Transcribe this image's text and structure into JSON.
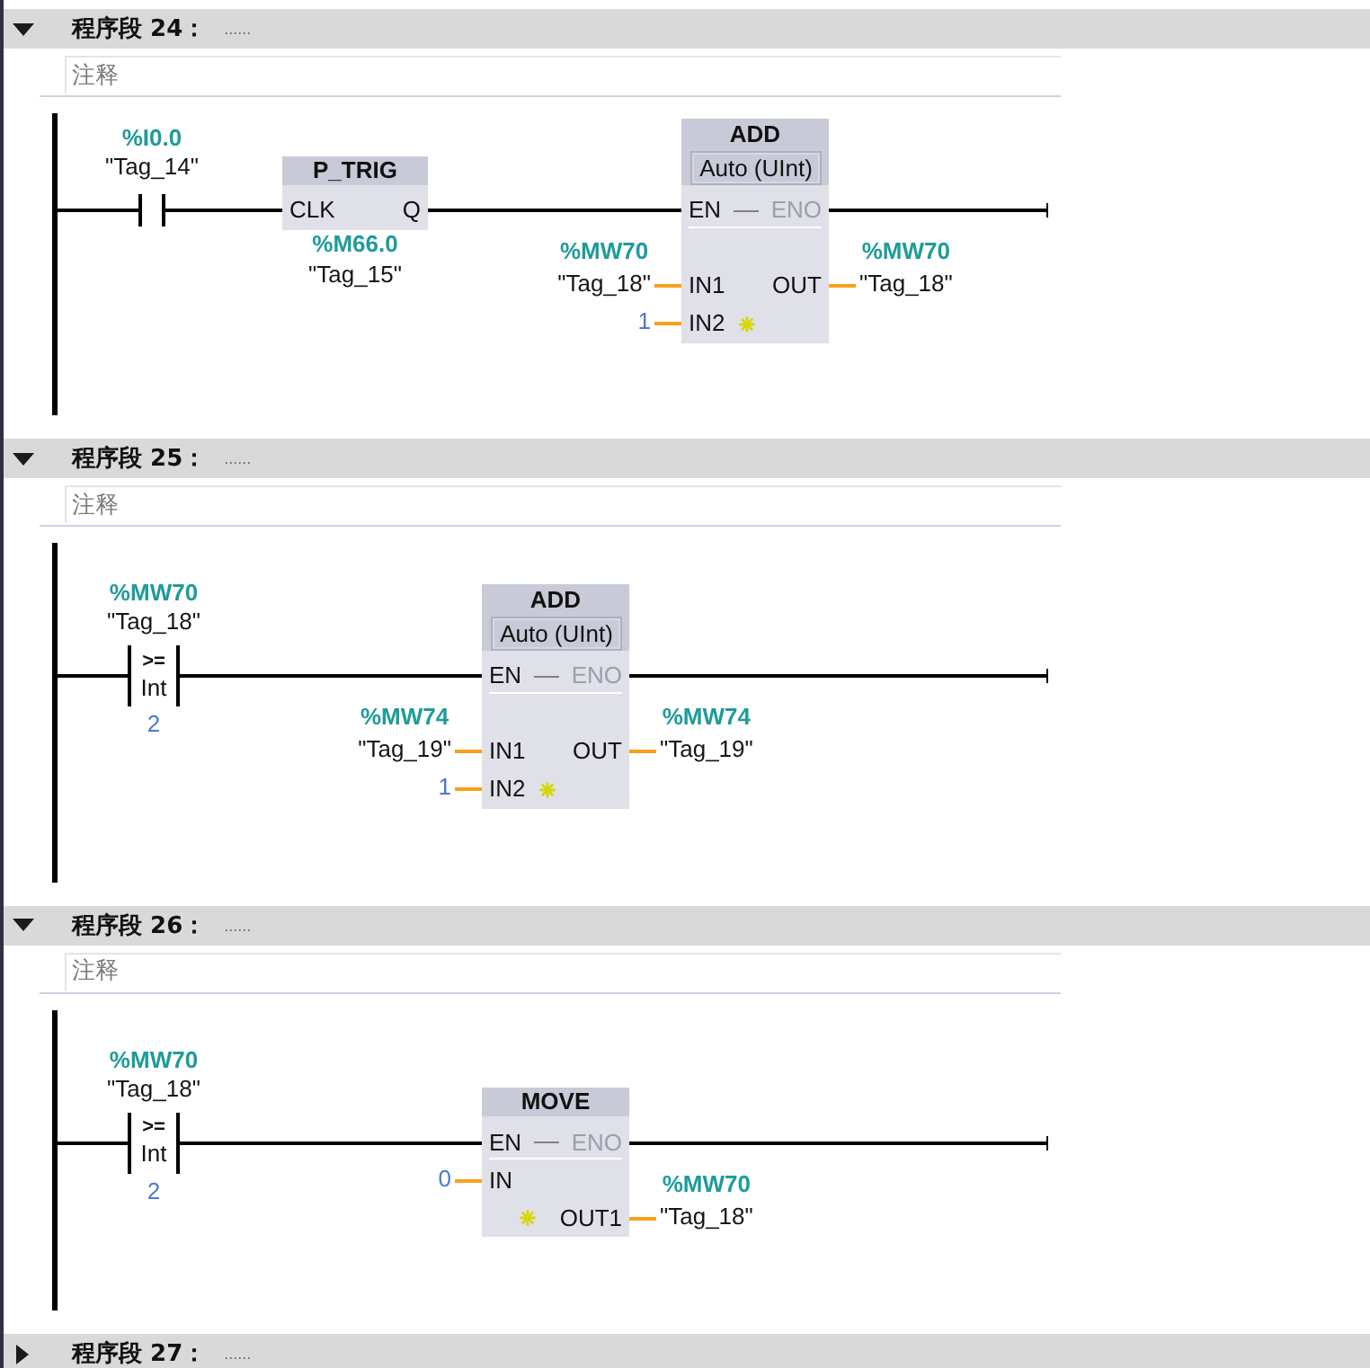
{
  "networks": [
    {
      "title": "程序段 24：",
      "title_field": {
        "placeholder": "......"
      },
      "expanded": true,
      "comment": {
        "placeholder": "注释"
      },
      "rung": [
        {
          "kind": "contact",
          "address": "%I0.0",
          "tag": "\"Tag_14\""
        },
        {
          "kind": "edge_box",
          "name": "P_TRIG",
          "input": "CLK",
          "output": "Q",
          "address": "%M66.0",
          "tag": "\"Tag_15\""
        },
        {
          "kind": "box",
          "name": "ADD",
          "data_type": "Auto (UInt)",
          "en": "EN",
          "eno": "ENO",
          "eno_enabled": false,
          "inputs": [
            {
              "pin": "IN1",
              "add_pin": false,
              "operand": {
                "address": "%MW70",
                "tag": "\"Tag_18\""
              }
            },
            {
              "pin": "IN2",
              "add_pin": true,
              "operand": {
                "constant": "1"
              }
            }
          ],
          "outputs": [
            {
              "pin": "OUT",
              "add_pin": false,
              "operand": {
                "address": "%MW70",
                "tag": "\"Tag_18\""
              }
            }
          ]
        }
      ]
    },
    {
      "title": "程序段 25：",
      "title_field": {
        "placeholder": "......"
      },
      "expanded": true,
      "comment": {
        "placeholder": "注释"
      },
      "rung": [
        {
          "kind": "compare",
          "operator": ">=",
          "data_type": "Int",
          "address": "%MW70",
          "tag": "\"Tag_18\"",
          "constant": "2"
        },
        {
          "kind": "box",
          "name": "ADD",
          "data_type": "Auto (UInt)",
          "en": "EN",
          "eno": "ENO",
          "eno_enabled": false,
          "inputs": [
            {
              "pin": "IN1",
              "add_pin": false,
              "operand": {
                "address": "%MW74",
                "tag": "\"Tag_19\""
              }
            },
            {
              "pin": "IN2",
              "add_pin": true,
              "operand": {
                "constant": "1"
              }
            }
          ],
          "outputs": [
            {
              "pin": "OUT",
              "add_pin": false,
              "operand": {
                "address": "%MW74",
                "tag": "\"Tag_19\""
              }
            }
          ]
        }
      ]
    },
    {
      "title": "程序段 26：",
      "title_field": {
        "placeholder": "......"
      },
      "expanded": true,
      "comment": {
        "placeholder": "注释"
      },
      "rung": [
        {
          "kind": "compare",
          "operator": ">=",
          "data_type": "Int",
          "address": "%MW70",
          "tag": "\"Tag_18\"",
          "constant": "2"
        },
        {
          "kind": "box",
          "name": "MOVE",
          "en": "EN",
          "eno": "ENO",
          "eno_enabled": false,
          "inputs": [
            {
              "pin": "IN",
              "add_pin": false,
              "operand": {
                "constant": "0"
              }
            }
          ],
          "outputs": [
            {
              "pin": "OUT1",
              "add_pin": true,
              "operand": {
                "address": "%MW70",
                "tag": "\"Tag_18\""
              }
            }
          ]
        }
      ]
    },
    {
      "title": "程序段 27：",
      "title_field": {
        "placeholder": "......"
      },
      "expanded": false
    }
  ]
}
